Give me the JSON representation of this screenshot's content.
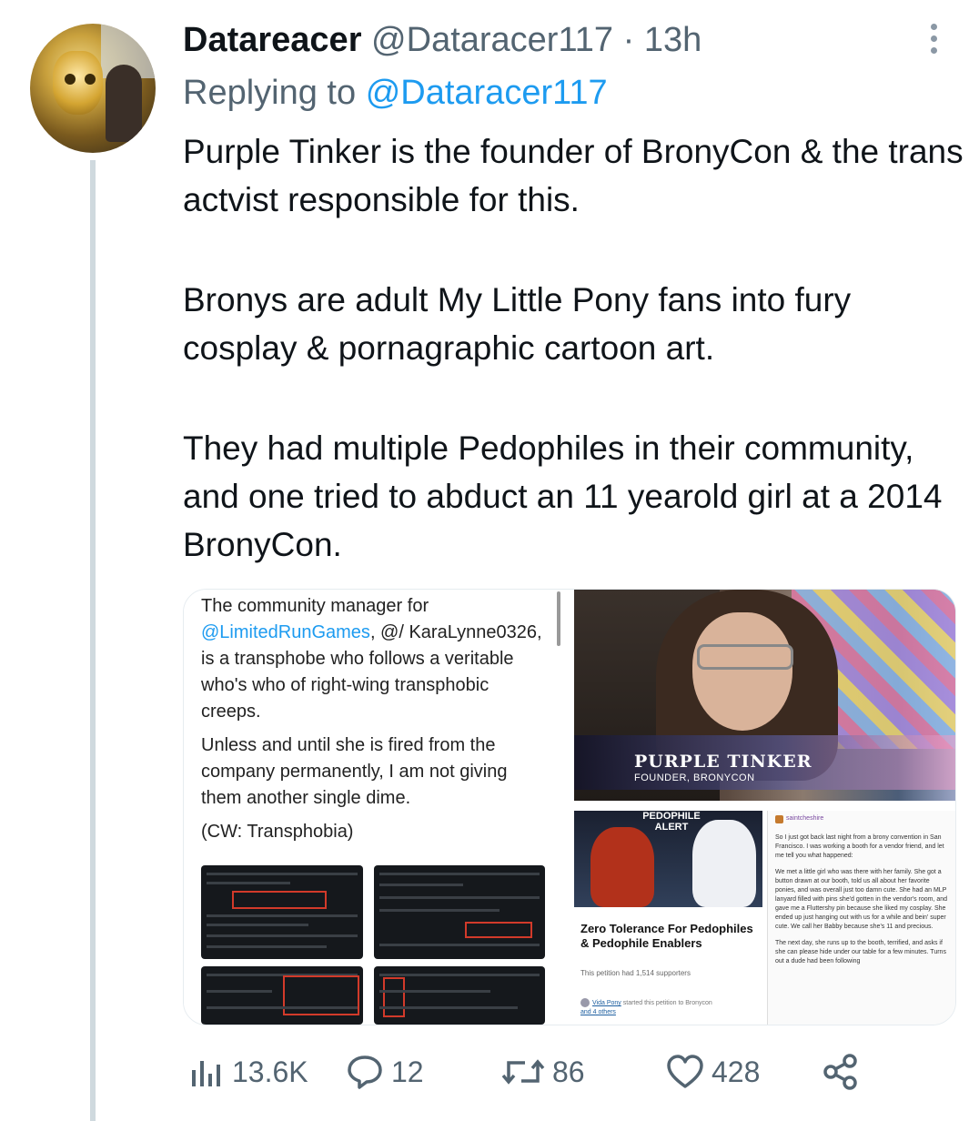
{
  "tweet": {
    "display_name": "Datareacer",
    "handle": "@Dataracer117",
    "separator": "·",
    "time": "13h",
    "replying_prefix": "Replying to",
    "replying_to": "@Dataracer117",
    "paragraphs": [
      "Purple Tinker is the founder of BronyCon & the trans actvist responsible for this.",
      "Bronys are adult My Little Pony fans into fury cosplay & pornagraphic cartoon art.",
      "They had multiple Pedophiles in their community, and one tried to abduct an 11 yearold girl at a 2014 BronyCon."
    ]
  },
  "media": {
    "quote_card": {
      "line1_prefix": "The community manager for",
      "line1_link": "@LimitedRunGames",
      "line1_rest": ", @/ KaraLynne0326, is a transphobe who follows a veritable who's who of right-wing transphobic creeps.",
      "para2": "Unless and until she is fired from the company permanently, I am not giving them another single dime.",
      "para3": "(CW: Transphobia)"
    },
    "video_still": {
      "title": "PURPLE TINKER",
      "subtitle": "FOUNDER, BRONYCON"
    },
    "petition": {
      "banner": "PEDOPHILE ALERT",
      "title": "Zero Tolerance For Pedophiles & Pedophile Enablers",
      "count": "This petition had 1,514 supporters",
      "starter_name": "Vida Pony",
      "starter_text": "started this petition to Bronycon",
      "starter_more": "and 4 others"
    },
    "post": {
      "username": "saintcheshire",
      "para1": "So I just got back last night from a brony convention in San Francisco. I was working a booth for a vendor friend, and let me tell you what happened:",
      "para2": "We met a little girl who was there with her family. She got a button drawn at our booth, told us all about her favorite ponies, and was overall just too damn cute. She had an MLP lanyard filled with pins she'd gotten in the vendor's room, and gave me a Fluttershy pin because she liked my cosplay. She ended up just hanging out with us for a while and bein' super cute. We call her Babby because she's 11 and precious.",
      "para3": "The next day, she runs up to the booth, terrified, and asks if she can please hide under our table for a few minutes. Turns out a dude had been following"
    }
  },
  "actions": {
    "views": "13.6K",
    "replies": "12",
    "retweets": "86",
    "likes": "428"
  },
  "colors": {
    "link": "#1d9bf0",
    "secondary_text": "#536471",
    "thread_line": "#cfd9de"
  }
}
